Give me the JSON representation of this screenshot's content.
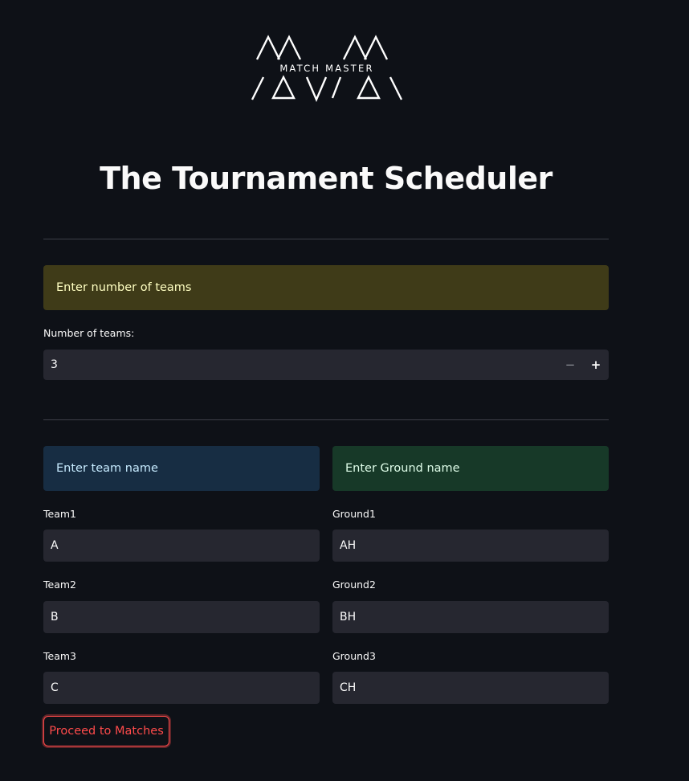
{
  "logo": {
    "text": "MATCH MASTER"
  },
  "title": "The Tournament Scheduler",
  "teams_section": {
    "alert": "Enter number of teams",
    "number_label": "Number of teams:",
    "number_value": "3",
    "minus_symbol": "−",
    "plus_symbol": "+"
  },
  "names_section": {
    "team_alert": "Enter team name",
    "ground_alert": "Enter Ground name",
    "teams": [
      {
        "label": "Team1",
        "value": "A"
      },
      {
        "label": "Team2",
        "value": "B"
      },
      {
        "label": "Team3",
        "value": "C"
      }
    ],
    "grounds": [
      {
        "label": "Ground1",
        "value": "AH"
      },
      {
        "label": "Ground2",
        "value": "BH"
      },
      {
        "label": "Ground3",
        "value": "CH"
      }
    ]
  },
  "proceed_button": "Proceed to Matches",
  "colors": {
    "background": "#0e1117",
    "warning_bg": "#3f3b18",
    "info_bg": "#172d43",
    "success_bg": "#173928",
    "input_bg": "#262730",
    "accent": "#ff4b4b"
  }
}
